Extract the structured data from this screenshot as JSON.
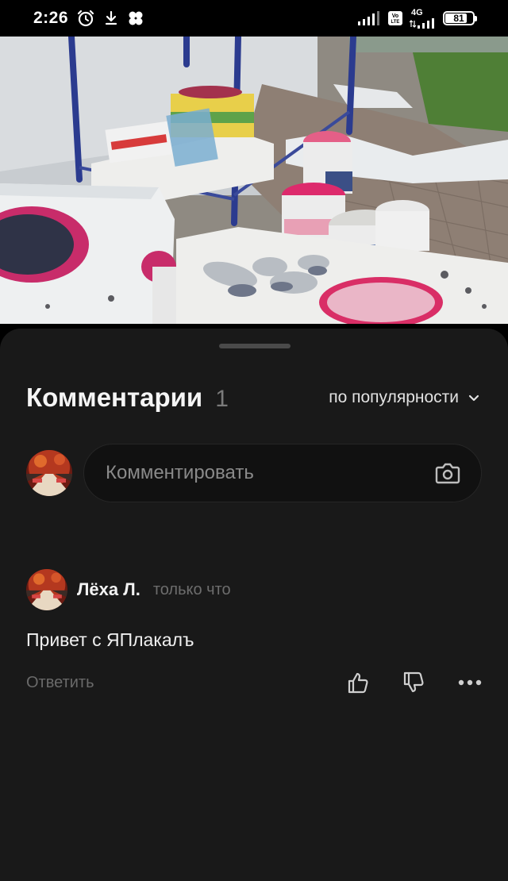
{
  "status_bar": {
    "time": "2:26",
    "network_type": "4G",
    "volte": "Vo LTE",
    "battery_percent": 81,
    "battery_label": "81",
    "icons": [
      "alarm-icon",
      "download-icon",
      "app-icon",
      "signal-icon",
      "signal-icon",
      "battery-icon"
    ]
  },
  "photo": {
    "description_icon": "construction-photo"
  },
  "comments_sheet": {
    "title": "Комментарии",
    "count": "1",
    "sort_label": "по популярности",
    "input_placeholder": "Комментировать",
    "camera_icon": "camera-icon"
  },
  "comments": [
    {
      "author": "Лёха Л.",
      "time": "только что",
      "text": "Привет с ЯПлакалъ",
      "reply_label": "Ответить",
      "icons": [
        "thumb-up-icon",
        "thumb-down-icon",
        "more-icon"
      ]
    }
  ],
  "colors": {
    "sheet_bg": "#191919",
    "input_bg": "#111111",
    "muted_text": "#7b7b7b"
  }
}
